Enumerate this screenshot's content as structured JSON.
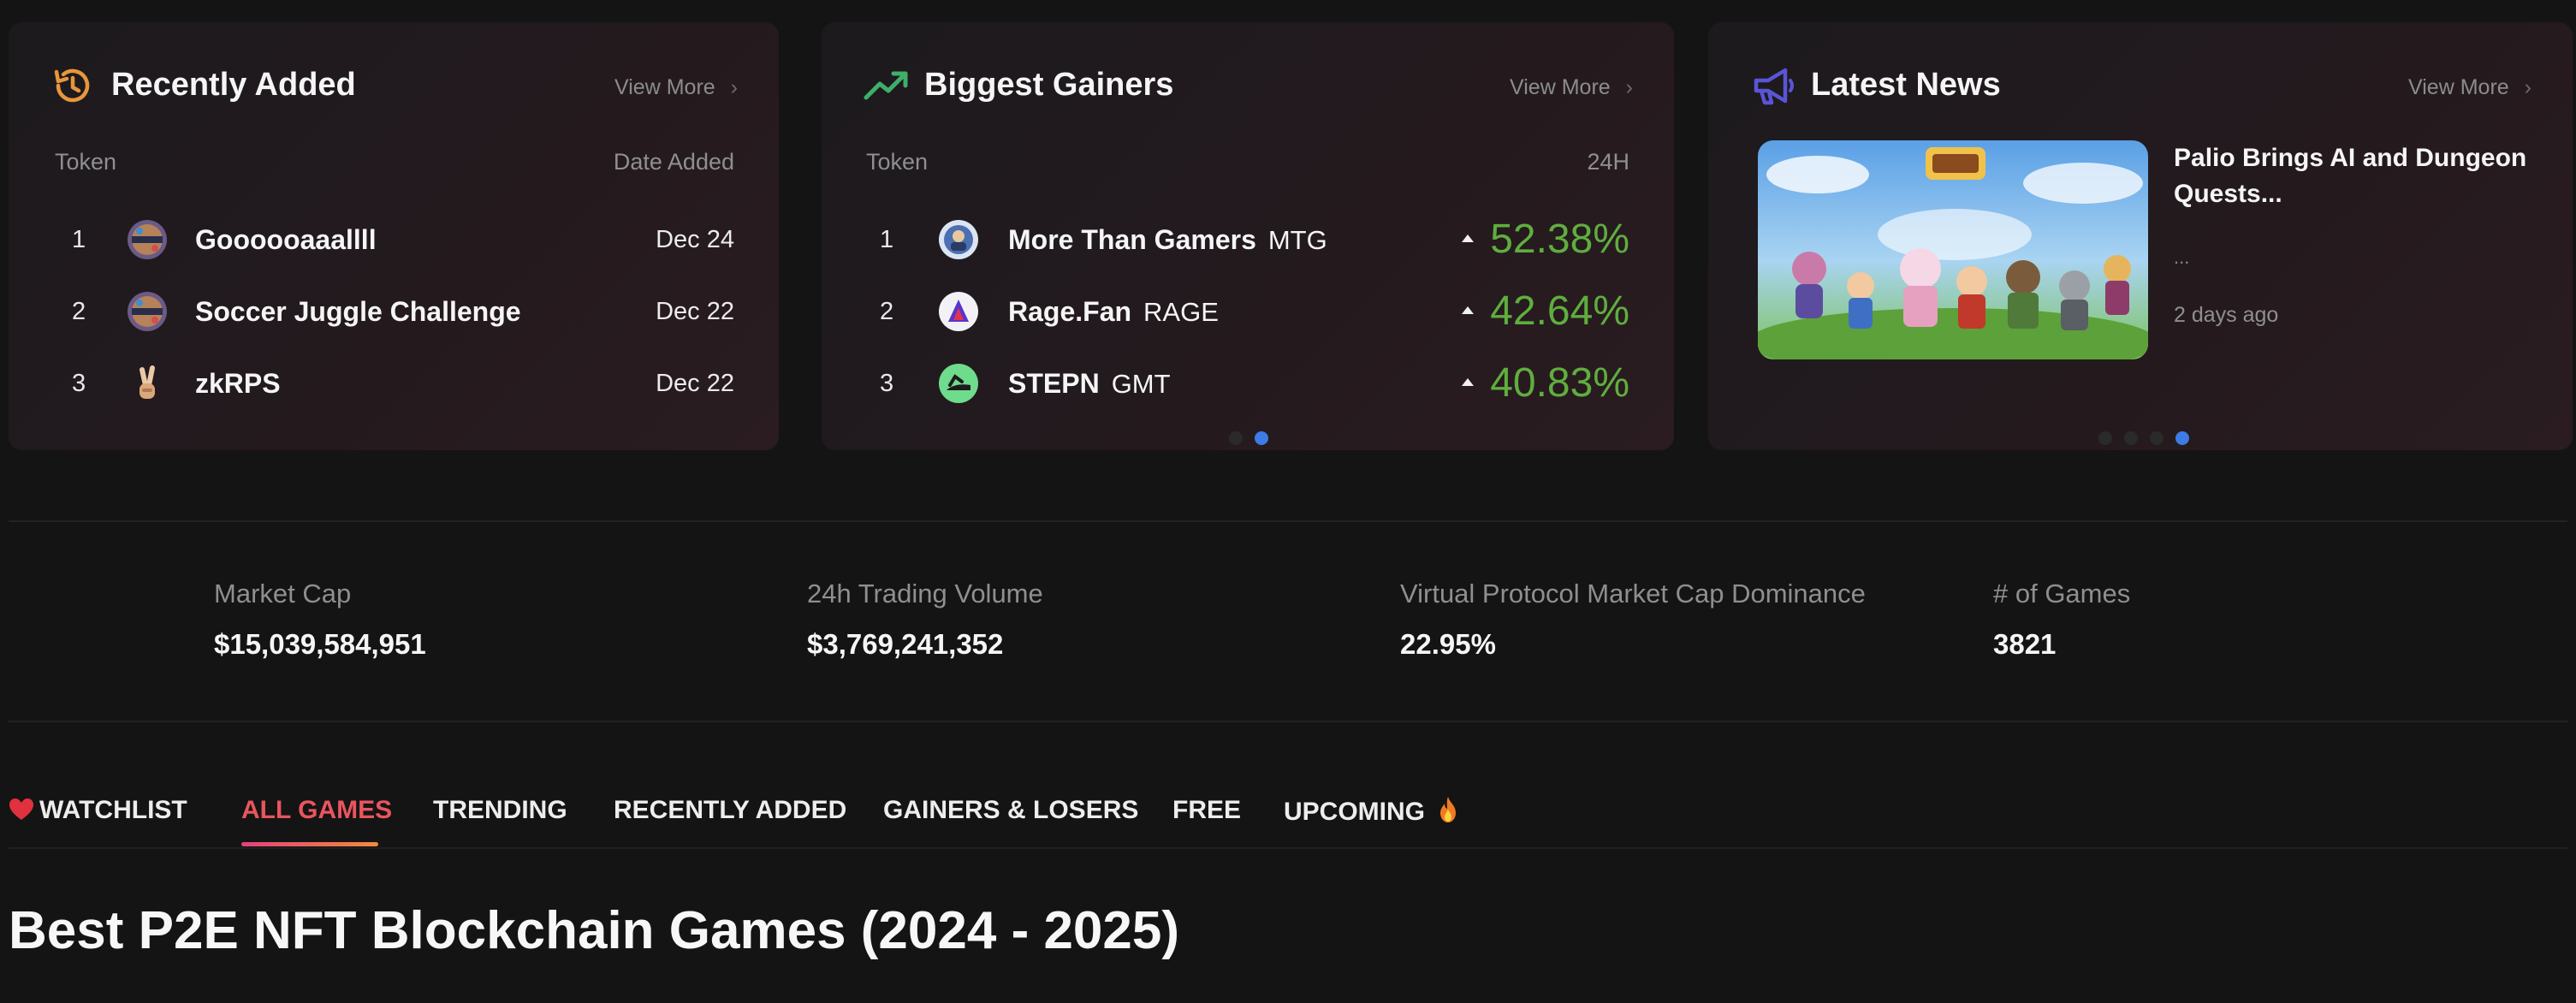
{
  "recently_added": {
    "title": "Recently Added",
    "icon": "history-icon",
    "view_more": "View More",
    "col_token": "Token",
    "col_date": "Date Added",
    "rows": [
      {
        "rank": "1",
        "name": "Goooooaaallll",
        "date": "Dec 24",
        "icon": "fusion-logo-icon"
      },
      {
        "rank": "2",
        "name": "Soccer Juggle Challenge",
        "date": "Dec 22",
        "icon": "fusion-logo-icon"
      },
      {
        "rank": "3",
        "name": "zkRPS",
        "date": "Dec 22",
        "icon": "victory-hand-icon"
      }
    ]
  },
  "biggest_gainers": {
    "title": "Biggest Gainers",
    "icon": "trending-up-icon",
    "view_more": "View More",
    "col_token": "Token",
    "col_change": "24H",
    "rows": [
      {
        "rank": "1",
        "name": "More Than Gamers",
        "symbol": "MTG",
        "change": "52.38%",
        "icon": "mtg-logo-icon"
      },
      {
        "rank": "2",
        "name": "Rage.Fan",
        "symbol": "RAGE",
        "change": "42.64%",
        "icon": "rage-logo-icon"
      },
      {
        "rank": "3",
        "name": "STEPN",
        "symbol": "GMT",
        "change": "40.83%",
        "icon": "stepn-logo-icon"
      }
    ],
    "page_count": 2,
    "active_page": 2
  },
  "latest_news": {
    "title": "Latest News",
    "icon": "megaphone-icon",
    "view_more": "View More",
    "article": {
      "title": "Palio Brings AI and Dungeon Quests...",
      "snippet": "...",
      "time": "2 days ago"
    },
    "page_count": 4,
    "active_page": 4
  },
  "stats": [
    {
      "label": "Market Cap",
      "value": "$15,039,584,951"
    },
    {
      "label": "24h Trading Volume",
      "value": "$3,769,241,352"
    },
    {
      "label": "Virtual Protocol Market Cap Dominance",
      "value": "22.95%"
    },
    {
      "label": "# of Games",
      "value": "3821"
    }
  ],
  "tabs": [
    {
      "label": "WATCHLIST",
      "icon": "heart-icon"
    },
    {
      "label": "ALL GAMES",
      "active": true
    },
    {
      "label": "TRENDING"
    },
    {
      "label": "RECENTLY ADDED"
    },
    {
      "label": "GAINERS & LOSERS"
    },
    {
      "label": "FREE"
    },
    {
      "label": "UPCOMING",
      "icon": "fire-icon"
    }
  ],
  "page_heading": "Best P2E NFT Blockchain Games (2024 - 2025)",
  "colors": {
    "background": "#141414",
    "gain_green": "#5fae3e",
    "active_tab": "#e9555e",
    "dot_active": "#3d7be6",
    "icon_orange": "#e8963c",
    "icon_green": "#3fae6a",
    "icon_indigo": "#5a54d6"
  }
}
